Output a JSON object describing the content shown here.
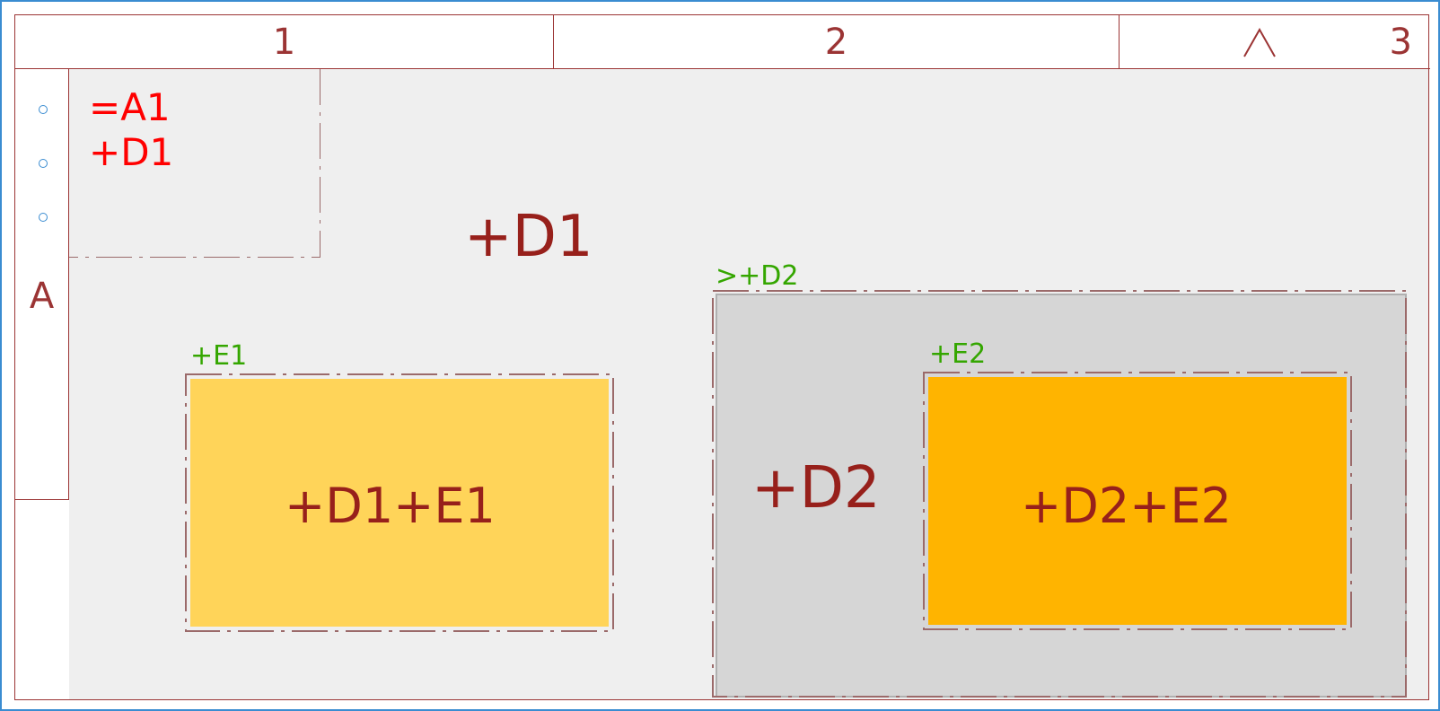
{
  "header": {
    "col1": "1",
    "col2": "2",
    "col3": "3"
  },
  "rows": {
    "rowA": "A"
  },
  "sheet": {
    "func": "=A1",
    "loc": "+D1"
  },
  "areas": {
    "d1_label": "+D1",
    "d2_tag": ">+D2",
    "d2_label": "+D2",
    "e1_tag": "+E1",
    "e1_label": "+D1+E1",
    "e2_tag": "+E2",
    "e2_label": "+D2+E2"
  },
  "colors": {
    "frame": "#9b3434",
    "selection": "#3a8cd1",
    "tag_green": "#34a600",
    "text_red": "#97201b",
    "active_red": "#ff0000",
    "box_light": "#ffd459",
    "box_dark": "#ffb400",
    "area_bg": "#efefef",
    "area_d2": "#d6d6d6"
  }
}
